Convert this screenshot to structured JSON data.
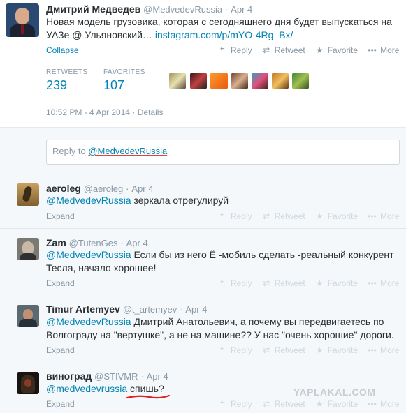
{
  "main_tweet": {
    "name": "Дмитрий Медведев",
    "handle": "@MedvedevRussia",
    "separator": "·",
    "time": "Apr 4",
    "text_line1": "Новая модель грузовика, которая с сегодняшнего дня будет выпускаться на",
    "text_line2": "УАЗе @ Ульяновский…",
    "link": "instagram.com/p/mYO-4Rg_Bx/",
    "collapse_label": "Collapse",
    "actions": {
      "reply": "Reply",
      "retweet": "Retweet",
      "favorite": "Favorite",
      "more": "More"
    },
    "stats": {
      "retweets_label": "RETWEETS",
      "retweets_value": "239",
      "favorites_label": "FAVORITES",
      "favorites_value": "107"
    },
    "timestamp": "10:52 PM - 4 Apr 2014",
    "details_label": "Details"
  },
  "reply_box": {
    "prefix": "Reply to",
    "mention": "@MedvedevRussia"
  },
  "replies": [
    {
      "name": "aeroleg",
      "handle": "@aeroleg",
      "time": "Apr 4",
      "mention": "@MedvedevRussia",
      "text": "зеркала отрегулируй",
      "text_line2": "",
      "expand": "Expand"
    },
    {
      "name": "Zam",
      "handle": "@TutenGes",
      "time": "Apr 4",
      "mention": "@MedvedevRussia",
      "text": "Если бы из него Ё -мобиль сделать -реальный конкурент",
      "text_line2": "Тесла, начало хорошее!",
      "expand": "Expand"
    },
    {
      "name": "Timur Artemyev",
      "handle": "@t_artemyev",
      "time": "Apr 4",
      "mention": "@MedvedevRussia",
      "text": "Дмитрий Анатольевич, а почему вы передвигаетесь по",
      "text_line2": "Волгограду на \"вертушке\", а не на машине?? У нас \"очень хорошие\" дороги.",
      "expand": "Expand"
    },
    {
      "name": "виноград",
      "handle": "@STIVMR",
      "time": "Apr 4",
      "mention": "@medvedevrussia",
      "text": "спишь?",
      "text_line2": "",
      "expand": "Expand"
    }
  ],
  "reply_actions": {
    "reply": "Reply",
    "retweet": "Retweet",
    "favorite": "Favorite",
    "more": "More"
  },
  "watermark": "YAPLAKAL.COM",
  "colors": {
    "link": "#0084b4",
    "muted": "#8899a6",
    "text": "#292f33",
    "reply_bg": "#f5f8fa"
  }
}
